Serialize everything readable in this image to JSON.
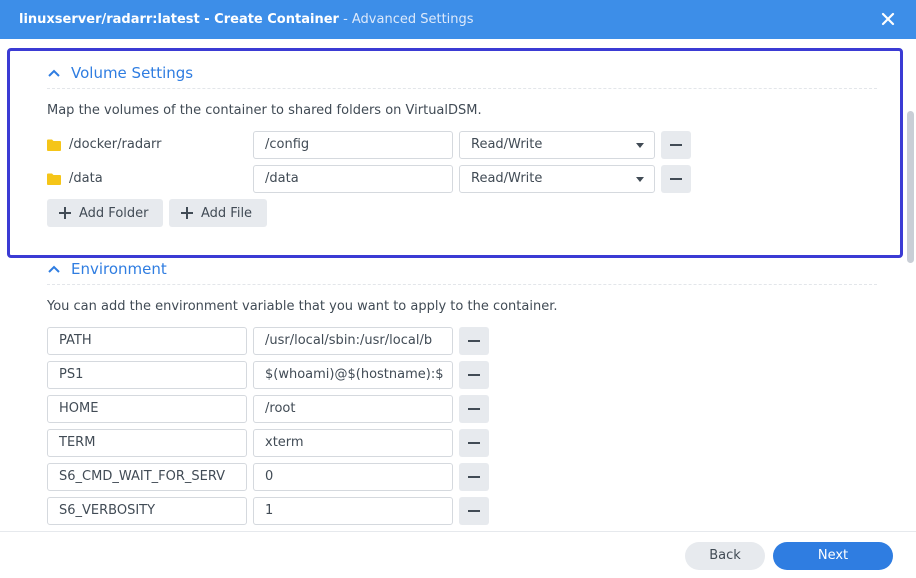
{
  "window": {
    "title_image": "linuxserver/radarr:latest",
    "title_separator": " - ",
    "title_action": "Create Container",
    "title_step": " - Advanced Settings",
    "close_icon": "close-icon"
  },
  "volume_settings": {
    "title": "Volume Settings",
    "description": "Map the volumes of the container to shared folders on VirtualDSM.",
    "rows": [
      {
        "folder": "/docker/radarr",
        "mount_path": "/config",
        "permission": "Read/Write"
      },
      {
        "folder": "/data",
        "mount_path": "/data",
        "permission": "Read/Write"
      }
    ],
    "add_folder_label": "Add Folder",
    "add_file_label": "Add File"
  },
  "environment": {
    "title": "Environment",
    "description": "You can add the environment variable that you want to apply to the container.",
    "variables": [
      {
        "key": "PATH",
        "value": "/usr/local/sbin:/usr/local/b"
      },
      {
        "key": "PS1",
        "value": "$(whoami)@$(hostname):$"
      },
      {
        "key": "HOME",
        "value": "/root"
      },
      {
        "key": "TERM",
        "value": "xterm"
      },
      {
        "key": "S6_CMD_WAIT_FOR_SERV",
        "value": "0"
      },
      {
        "key": "S6_VERBOSITY",
        "value": "1"
      }
    ]
  },
  "footer": {
    "back_label": "Back",
    "next_label": "Next"
  },
  "colors": {
    "titlebar": "#3d8ee8",
    "accent": "#2f7de1",
    "highlight": "#3b3bd4",
    "folder": "#f5c518"
  }
}
